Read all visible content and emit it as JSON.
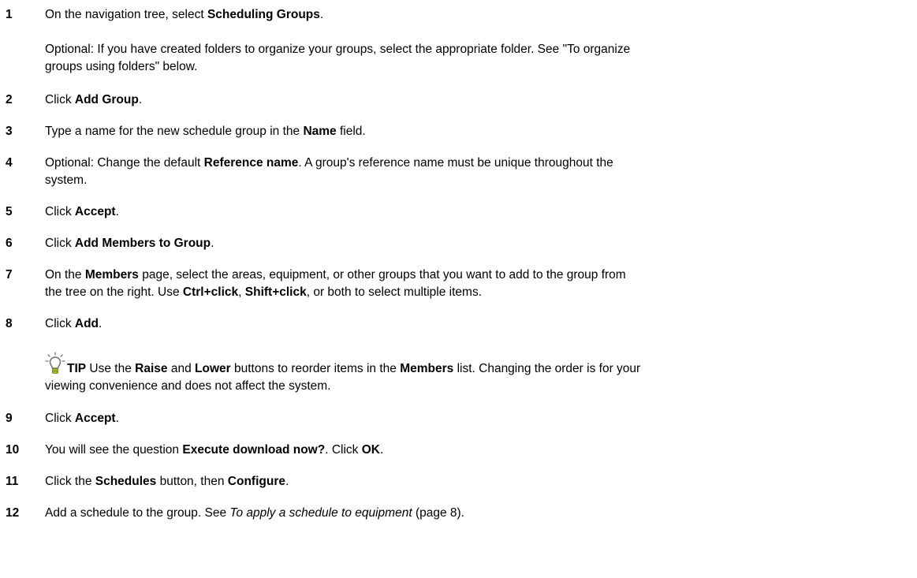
{
  "steps": [
    {
      "num": "1",
      "parts": [
        {
          "t": "On the navigation tree, select "
        },
        {
          "t": "Scheduling Groups",
          "b": true
        },
        {
          "t": "."
        }
      ]
    },
    {
      "note": [
        "Optional:  If you have created folders to organize your groups, select the appropriate folder. See \"To organize",
        "groups using folders\" below."
      ]
    },
    {
      "num": "2",
      "parts": [
        {
          "t": "Click "
        },
        {
          "t": "Add Group",
          "b": true
        },
        {
          "t": "."
        }
      ]
    },
    {
      "num": "3",
      "parts": [
        {
          "t": "Type a name for the new schedule group in the "
        },
        {
          "t": "Name",
          "b": true
        },
        {
          "t": " field."
        }
      ]
    },
    {
      "num": "4",
      "parts": [
        {
          "t": "Optional:  Change the default "
        },
        {
          "t": "Reference name",
          "b": true
        },
        {
          "t": ". A group's reference name must be unique throughout the"
        }
      ],
      "cont": "system."
    },
    {
      "num": "5",
      "parts": [
        {
          "t": "Click "
        },
        {
          "t": "Accept",
          "b": true
        },
        {
          "t": "."
        }
      ]
    },
    {
      "num": "6",
      "parts": [
        {
          "t": "Click "
        },
        {
          "t": "Add Members to Group",
          "b": true
        },
        {
          "t": "."
        }
      ]
    },
    {
      "num": "7",
      "parts": [
        {
          "t": "On the "
        },
        {
          "t": "Members",
          "b": true
        },
        {
          "t": " page, select the areas, equipment, or other groups that you want to add to the group from"
        }
      ],
      "cont_parts": [
        {
          "t": "the tree on the right. Use "
        },
        {
          "t": "Ctrl+click",
          "b": true
        },
        {
          "t": ", "
        },
        {
          "t": "Shift+click",
          "b": true
        },
        {
          "t": ", or both to select multiple items."
        }
      ]
    },
    {
      "num": "8",
      "parts": [
        {
          "t": "Click "
        },
        {
          "t": "Add",
          "b": true
        },
        {
          "t": "."
        }
      ]
    },
    {
      "tip_parts": [
        {
          "t": "TIP",
          "b": true
        },
        {
          "t": "  Use the "
        },
        {
          "t": "Raise",
          "b": true
        },
        {
          "t": " and "
        },
        {
          "t": "Lower",
          "b": true
        },
        {
          "t": " buttons to reorder items in the "
        },
        {
          "t": "Members",
          "b": true
        },
        {
          "t": " list. Changing the order is for your"
        }
      ],
      "tip_cont": "viewing convenience and does not affect the system."
    },
    {
      "num": "9",
      "parts": [
        {
          "t": "Click "
        },
        {
          "t": "Accept",
          "b": true
        },
        {
          "t": "."
        }
      ]
    },
    {
      "num": "10",
      "parts": [
        {
          "t": "You will see the question "
        },
        {
          "t": "Execute download now?",
          "b": true
        },
        {
          "t": ". Click "
        },
        {
          "t": "OK",
          "b": true
        },
        {
          "t": "."
        }
      ]
    },
    {
      "num": "11",
      "parts": [
        {
          "t": "Click the "
        },
        {
          "t": "Schedules",
          "b": true
        },
        {
          "t": " button, then "
        },
        {
          "t": "Configure",
          "b": true
        },
        {
          "t": "."
        }
      ]
    },
    {
      "num": "12",
      "parts": [
        {
          "t": "Add a schedule to the group. See "
        },
        {
          "t": "To apply a schedule to equipment",
          "i": true
        },
        {
          "t": " (page 8)."
        }
      ]
    }
  ]
}
